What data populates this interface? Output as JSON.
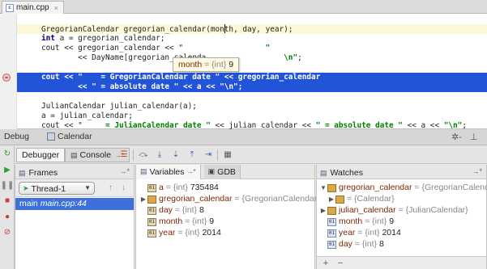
{
  "editor": {
    "tab_label": "main.cpp",
    "file_icon": "c",
    "close_glyph": "×",
    "lines": [
      {
        "parts": [
          [
            "plain",
            "GregorianCalendar gregorian_calendar(mon"
          ],
          [
            "caret",
            ""
          ],
          [
            "plain",
            "th, day, year);"
          ]
        ]
      },
      {
        "parts": [
          [
            "kw",
            "int"
          ],
          [
            "plain",
            " a = gregorian_calendar;"
          ]
        ]
      },
      {
        "parts": [
          [
            "plain",
            "cout << gregorian_calendar << \""
          ],
          [
            "plain",
            "                  "
          ],
          [
            "str",
            "\""
          ]
        ]
      },
      {
        "parts": [
          [
            "plain",
            "        << DayName[gregorian_calenda"
          ],
          [
            "plain",
            "                 "
          ],
          [
            "str",
            "\\n\""
          ],
          [
            "plain",
            ";"
          ]
        ]
      },
      {
        "parts": [
          [
            "plain",
            ""
          ]
        ]
      },
      {
        "parts": [
          [
            "plain",
            "cout << \"    = GregorianCalendar date \" << gregorian_calendar"
          ]
        ]
      },
      {
        "parts": [
          [
            "plain",
            "        << \" = absolute date \" << a << \"\\n\";"
          ]
        ]
      },
      {
        "parts": [
          [
            "plain",
            ""
          ]
        ]
      },
      {
        "parts": [
          [
            "plain",
            "JulianCalendar julian_calendar(a);"
          ]
        ]
      },
      {
        "parts": [
          [
            "plain",
            "a = julian_calendar;"
          ]
        ]
      },
      {
        "parts": [
          [
            "plain",
            "cout << \""
          ],
          [
            "str",
            "     = JulianCalendar date \""
          ],
          [
            "plain",
            " << julian_calendar << "
          ],
          [
            "str",
            "\" = absolute date \""
          ],
          [
            "plain",
            " << a << "
          ],
          [
            "str",
            "\"\\n\""
          ],
          [
            "plain",
            ";"
          ]
        ]
      }
    ],
    "exec_lines_raw": [
      "cout << \"    = GregorianCalendar date \" << gregorian_calendar",
      "        << \" = absolute date \" << a << \"\\n\";"
    ]
  },
  "tooltip": {
    "name": "month",
    "type": "= {int}",
    "value": "9"
  },
  "debug": {
    "title": "Debug",
    "config": "Calendar",
    "gear_glyph": "✲-",
    "minimize_glyph": "⊥",
    "tabs": {
      "debugger": "Debugger",
      "console": "Console",
      "console_pin": "→*"
    },
    "frames": {
      "title": "Frames",
      "pin": "→*",
      "thread": "Thread-1",
      "row": {
        "name": "main",
        "location": "main.cpp:44"
      }
    },
    "variables": {
      "title": "Variables",
      "pin": "→*",
      "gdb_tab": "GDB",
      "rows": [
        {
          "twisty": "",
          "name": "a",
          "type": "= {int}",
          "value": "735484"
        },
        {
          "twisty": "▶",
          "name": "gregorian_calendar",
          "type": "= {GregorianCalendar}",
          "value": ""
        },
        {
          "twisty": "",
          "name": "day",
          "type": "= {int}",
          "value": "8"
        },
        {
          "twisty": "",
          "name": "month",
          "type": "= {int}",
          "value": "9"
        },
        {
          "twisty": "",
          "name": "year",
          "type": "= {int}",
          "value": "2014"
        }
      ]
    },
    "watches": {
      "title": "Watches",
      "pin": "→*",
      "rows": [
        {
          "twisty": "▼",
          "name": "gregorian_calendar",
          "type": "= {GregorianCalenda",
          "value": "",
          "indent": false
        },
        {
          "twisty": "▶",
          "name": "",
          "type": "= {Calendar}",
          "value": "",
          "indent": true
        },
        {
          "twisty": "▶",
          "name": "julian_calendar",
          "type": "= {JulianCalendar}",
          "value": "",
          "indent": false
        },
        {
          "twisty": "",
          "name": "month",
          "type": "= {int}",
          "value": "9",
          "indent": false
        },
        {
          "twisty": "",
          "name": "year",
          "type": "= {int}",
          "value": "2014",
          "indent": false
        },
        {
          "twisty": "",
          "name": "day",
          "type": "= {int}",
          "value": "8",
          "indent": false
        }
      ],
      "add": "+",
      "remove": "−"
    }
  },
  "colors": {
    "exec_line": "#2154d6",
    "selection": "#3f6fd8",
    "tooltip_bg": "#fffbe3"
  }
}
